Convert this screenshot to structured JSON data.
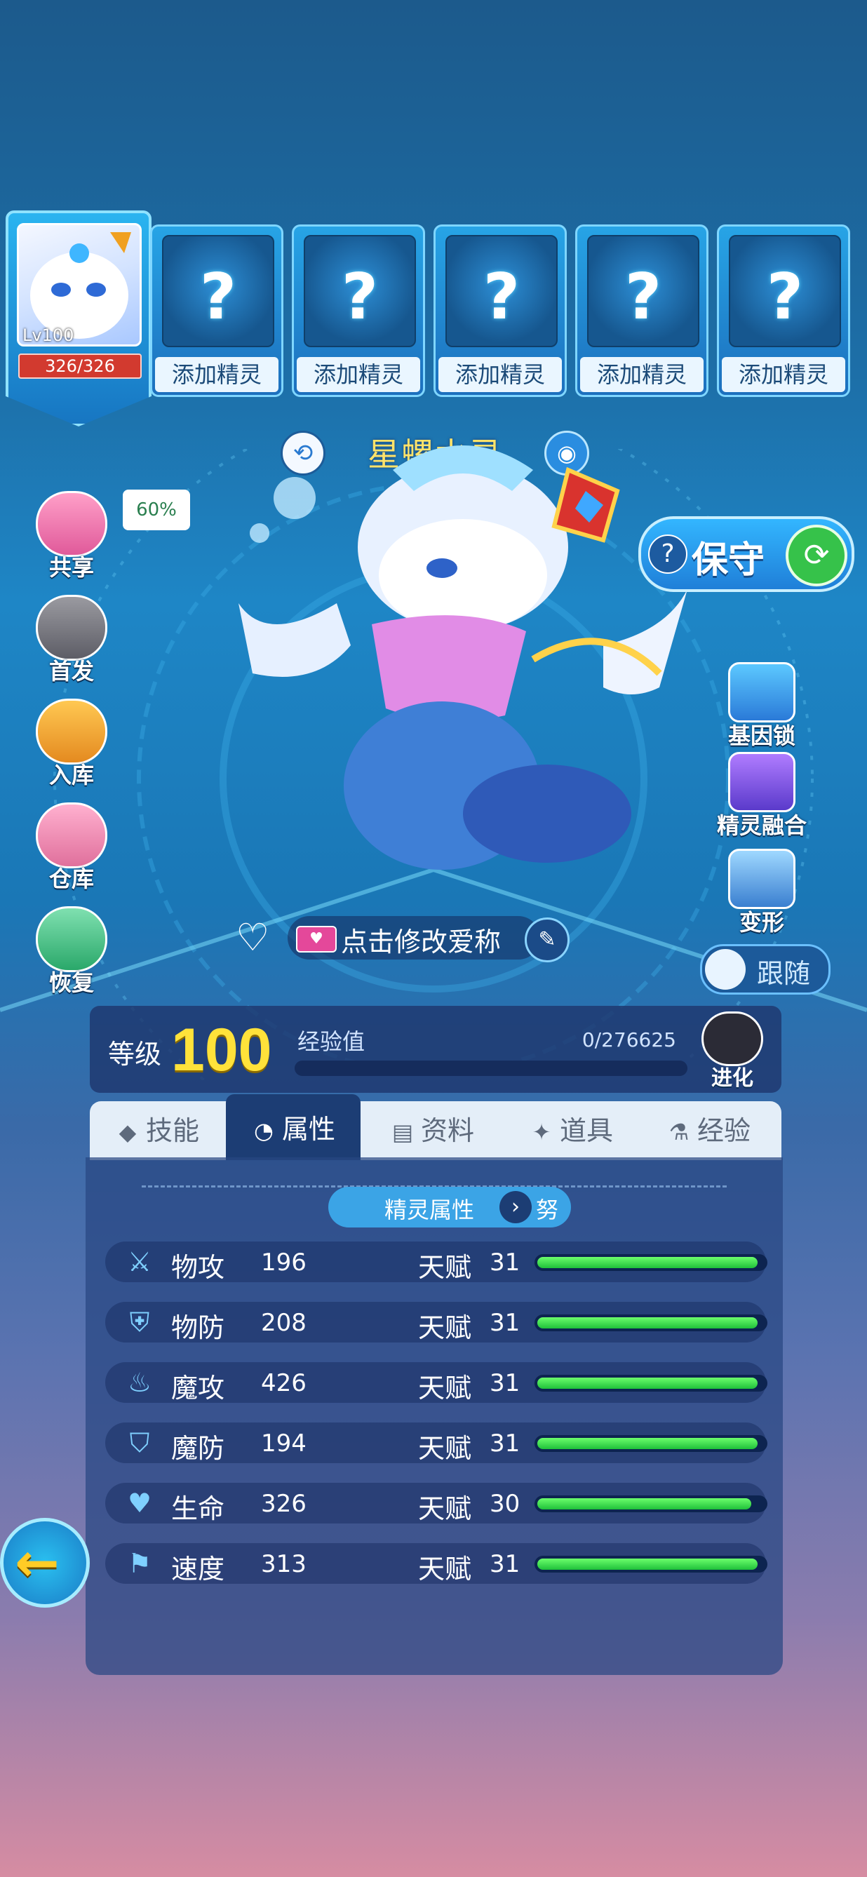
{
  "team": {
    "active": {
      "level": "Lv100",
      "hp": "326/326"
    },
    "empty_slots": [
      "添加精灵",
      "添加精灵",
      "添加精灵",
      "添加精灵",
      "添加精灵"
    ],
    "empty_mark": "?"
  },
  "pet": {
    "name": "星螺水灵",
    "nickname_hint": "点击修改爱称",
    "share_percent": "60%"
  },
  "left_menu": [
    {
      "label": "共享",
      "icon": "exp-share-icon"
    },
    {
      "label": "首发",
      "icon": "lead-icon"
    },
    {
      "label": "入库",
      "icon": "store-icon"
    },
    {
      "label": "仓库",
      "icon": "warehouse-icon"
    },
    {
      "label": "恢复",
      "icon": "heal-potion-icon"
    }
  ],
  "right_menu": {
    "guard_label": "保守",
    "guard_help": "?",
    "items": [
      {
        "label": "基因锁",
        "icon": "gene-lock-icon"
      },
      {
        "label": "精灵融合",
        "icon": "fusion-icon"
      },
      {
        "label": "变形",
        "icon": "transform-icon"
      }
    ],
    "follow_label": "跟随"
  },
  "level": {
    "label": "等级",
    "value": "100",
    "exp_label": "经验值",
    "exp_value": "0/276625",
    "exp_progress": 0,
    "evolve_label": "进化"
  },
  "tabs": [
    {
      "label": "技能",
      "icon": "skill-icon"
    },
    {
      "label": "属性",
      "icon": "attribute-icon",
      "active": true
    },
    {
      "label": "资料",
      "icon": "info-icon"
    },
    {
      "label": "道具",
      "icon": "item-icon"
    },
    {
      "label": "经验",
      "icon": "potion-icon"
    }
  ],
  "attributes": {
    "header": "精灵属性",
    "alt": "努",
    "talent_label": "天赋",
    "rows": [
      {
        "name": "物攻",
        "value": "196",
        "talent": "31",
        "talent_ratio": 0.97,
        "icon": "sword-icon"
      },
      {
        "name": "物防",
        "value": "208",
        "talent": "31",
        "talent_ratio": 0.97,
        "icon": "shield-icon"
      },
      {
        "name": "魔攻",
        "value": "426",
        "talent": "31",
        "talent_ratio": 0.97,
        "icon": "flame-icon"
      },
      {
        "name": "魔防",
        "value": "194",
        "talent": "31",
        "talent_ratio": 0.97,
        "icon": "magic-shield-icon"
      },
      {
        "name": "生命",
        "value": "326",
        "talent": "30",
        "talent_ratio": 0.94,
        "icon": "heart-plus-icon"
      },
      {
        "name": "速度",
        "value": "313",
        "talent": "31",
        "talent_ratio": 0.97,
        "icon": "boot-icon"
      }
    ]
  },
  "colors": {
    "accent": "#ffe23a",
    "bar_fill": "#2fd84a",
    "tab_active": "#1c3d74"
  }
}
